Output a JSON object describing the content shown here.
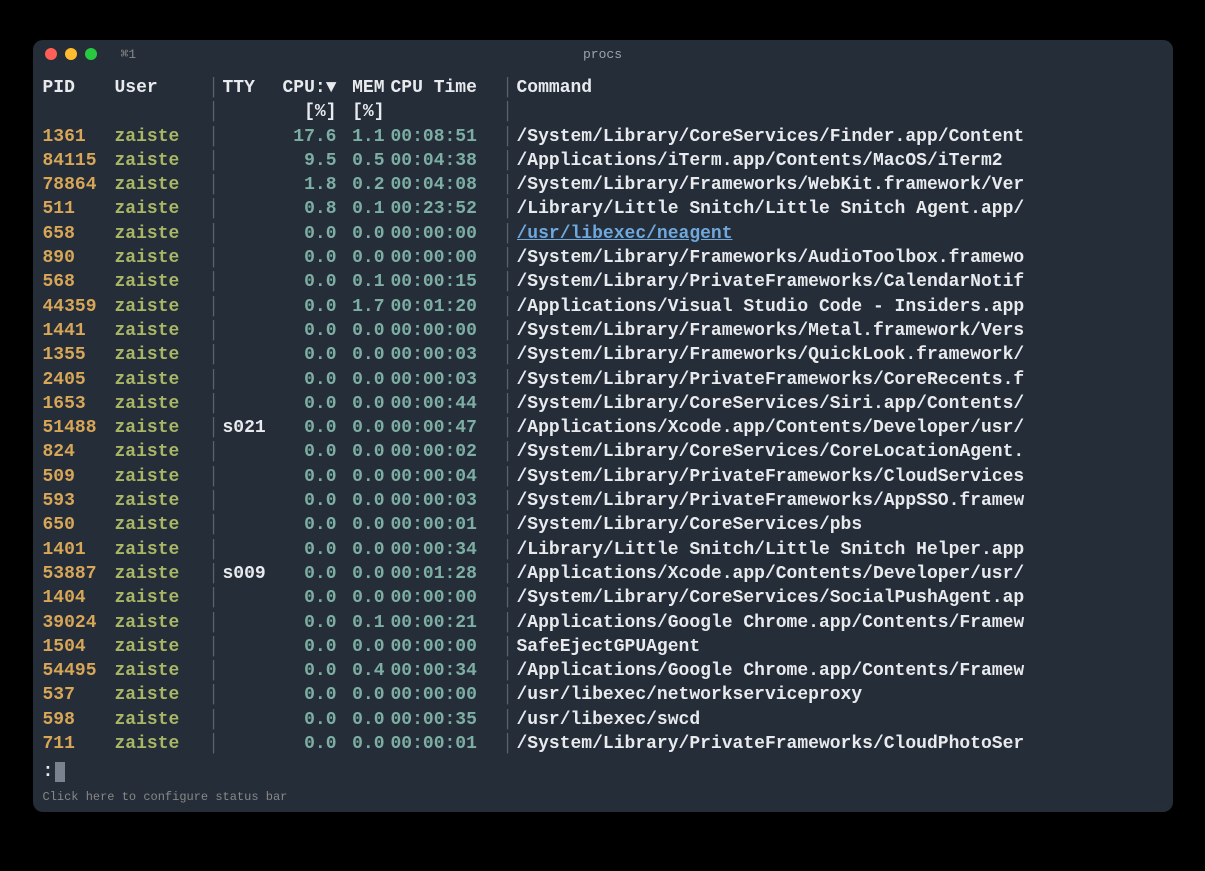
{
  "window": {
    "tab_label": "⌘1",
    "title": "procs",
    "status_bar": "Click here to configure status bar",
    "prompt_char": ":"
  },
  "headers": {
    "pid": "PID",
    "user": "User",
    "tty": "TTY",
    "cpu": "CPU:",
    "sort_arrow": "▼",
    "mem": "MEM",
    "cputime": "CPU Time",
    "command": "Command",
    "sub_pct_cpu": "[%]",
    "sub_pct_mem": "[%]"
  },
  "sep": "│",
  "rows": [
    {
      "pid": "1361",
      "user": "zaiste",
      "tty": "",
      "cpu": "17.6",
      "mem": "1.1",
      "time": "00:08:51",
      "cmd": "/System/Library/CoreServices/Finder.app/Content"
    },
    {
      "pid": "84115",
      "user": "zaiste",
      "tty": "",
      "cpu": "9.5",
      "mem": "0.5",
      "time": "00:04:38",
      "cmd": "/Applications/iTerm.app/Contents/MacOS/iTerm2"
    },
    {
      "pid": "78864",
      "user": "zaiste",
      "tty": "",
      "cpu": "1.8",
      "mem": "0.2",
      "time": "00:04:08",
      "cmd": "/System/Library/Frameworks/WebKit.framework/Ver"
    },
    {
      "pid": "511",
      "user": "zaiste",
      "tty": "",
      "cpu": "0.8",
      "mem": "0.1",
      "time": "00:23:52",
      "cmd": "/Library/Little Snitch/Little Snitch Agent.app/"
    },
    {
      "pid": "658",
      "user": "zaiste",
      "tty": "",
      "cpu": "0.0",
      "mem": "0.0",
      "time": "00:00:00",
      "cmd": "/usr/libexec/neagent",
      "link": true
    },
    {
      "pid": "890",
      "user": "zaiste",
      "tty": "",
      "cpu": "0.0",
      "mem": "0.0",
      "time": "00:00:00",
      "cmd": "/System/Library/Frameworks/AudioToolbox.framewo"
    },
    {
      "pid": "568",
      "user": "zaiste",
      "tty": "",
      "cpu": "0.0",
      "mem": "0.1",
      "time": "00:00:15",
      "cmd": "/System/Library/PrivateFrameworks/CalendarNotif"
    },
    {
      "pid": "44359",
      "user": "zaiste",
      "tty": "",
      "cpu": "0.0",
      "mem": "1.7",
      "time": "00:01:20",
      "cmd": "/Applications/Visual Studio Code - Insiders.app"
    },
    {
      "pid": "1441",
      "user": "zaiste",
      "tty": "",
      "cpu": "0.0",
      "mem": "0.0",
      "time": "00:00:00",
      "cmd": "/System/Library/Frameworks/Metal.framework/Vers"
    },
    {
      "pid": "1355",
      "user": "zaiste",
      "tty": "",
      "cpu": "0.0",
      "mem": "0.0",
      "time": "00:00:03",
      "cmd": "/System/Library/Frameworks/QuickLook.framework/"
    },
    {
      "pid": "2405",
      "user": "zaiste",
      "tty": "",
      "cpu": "0.0",
      "mem": "0.0",
      "time": "00:00:03",
      "cmd": "/System/Library/PrivateFrameworks/CoreRecents.f"
    },
    {
      "pid": "1653",
      "user": "zaiste",
      "tty": "",
      "cpu": "0.0",
      "mem": "0.0",
      "time": "00:00:44",
      "cmd": "/System/Library/CoreServices/Siri.app/Contents/"
    },
    {
      "pid": "51488",
      "user": "zaiste",
      "tty": "s021",
      "cpu": "0.0",
      "mem": "0.0",
      "time": "00:00:47",
      "cmd": "/Applications/Xcode.app/Contents/Developer/usr/"
    },
    {
      "pid": "824",
      "user": "zaiste",
      "tty": "",
      "cpu": "0.0",
      "mem": "0.0",
      "time": "00:00:02",
      "cmd": "/System/Library/CoreServices/CoreLocationAgent."
    },
    {
      "pid": "509",
      "user": "zaiste",
      "tty": "",
      "cpu": "0.0",
      "mem": "0.0",
      "time": "00:00:04",
      "cmd": "/System/Library/PrivateFrameworks/CloudServices"
    },
    {
      "pid": "593",
      "user": "zaiste",
      "tty": "",
      "cpu": "0.0",
      "mem": "0.0",
      "time": "00:00:03",
      "cmd": "/System/Library/PrivateFrameworks/AppSSO.framew"
    },
    {
      "pid": "650",
      "user": "zaiste",
      "tty": "",
      "cpu": "0.0",
      "mem": "0.0",
      "time": "00:00:01",
      "cmd": "/System/Library/CoreServices/pbs"
    },
    {
      "pid": "1401",
      "user": "zaiste",
      "tty": "",
      "cpu": "0.0",
      "mem": "0.0",
      "time": "00:00:34",
      "cmd": "/Library/Little Snitch/Little Snitch Helper.app"
    },
    {
      "pid": "53887",
      "user": "zaiste",
      "tty": "s009",
      "cpu": "0.0",
      "mem": "0.0",
      "time": "00:01:28",
      "cmd": "/Applications/Xcode.app/Contents/Developer/usr/"
    },
    {
      "pid": "1404",
      "user": "zaiste",
      "tty": "",
      "cpu": "0.0",
      "mem": "0.0",
      "time": "00:00:00",
      "cmd": "/System/Library/CoreServices/SocialPushAgent.ap"
    },
    {
      "pid": "39024",
      "user": "zaiste",
      "tty": "",
      "cpu": "0.0",
      "mem": "0.1",
      "time": "00:00:21",
      "cmd": "/Applications/Google Chrome.app/Contents/Framew"
    },
    {
      "pid": "1504",
      "user": "zaiste",
      "tty": "",
      "cpu": "0.0",
      "mem": "0.0",
      "time": "00:00:00",
      "cmd": "SafeEjectGPUAgent"
    },
    {
      "pid": "54495",
      "user": "zaiste",
      "tty": "",
      "cpu": "0.0",
      "mem": "0.4",
      "time": "00:00:34",
      "cmd": "/Applications/Google Chrome.app/Contents/Framew"
    },
    {
      "pid": "537",
      "user": "zaiste",
      "tty": "",
      "cpu": "0.0",
      "mem": "0.0",
      "time": "00:00:00",
      "cmd": "/usr/libexec/networkserviceproxy"
    },
    {
      "pid": "598",
      "user": "zaiste",
      "tty": "",
      "cpu": "0.0",
      "mem": "0.0",
      "time": "00:00:35",
      "cmd": "/usr/libexec/swcd"
    },
    {
      "pid": "711",
      "user": "zaiste",
      "tty": "",
      "cpu": "0.0",
      "mem": "0.0",
      "time": "00:00:01",
      "cmd": "/System/Library/PrivateFrameworks/CloudPhotoSer"
    }
  ]
}
